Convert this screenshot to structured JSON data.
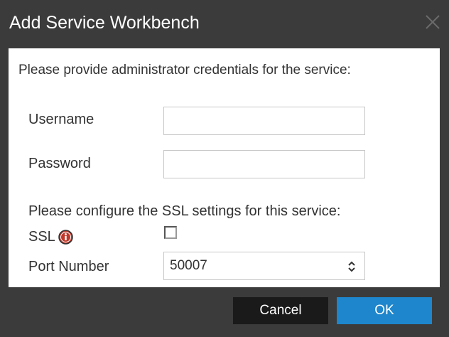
{
  "dialog": {
    "title": "Add Service Workbench",
    "close_icon": "close-icon"
  },
  "form": {
    "intro": "Please provide administrator credentials for the service:",
    "username_label": "Username",
    "username_value": "",
    "password_label": "Password",
    "password_value": "",
    "ssl_intro": "Please configure the SSL settings for this service:",
    "ssl_label": "SSL",
    "ssl_checked": false,
    "info_icon": "info-icon",
    "port_label": "Port Number",
    "port_value": "50007"
  },
  "buttons": {
    "cancel_label": "Cancel",
    "ok_label": "OK"
  },
  "colors": {
    "dialog_bg": "#3b3b3b",
    "ok_button": "#1d86cc",
    "cancel_button": "#1a1a1a",
    "info_icon": "#c0392b"
  }
}
